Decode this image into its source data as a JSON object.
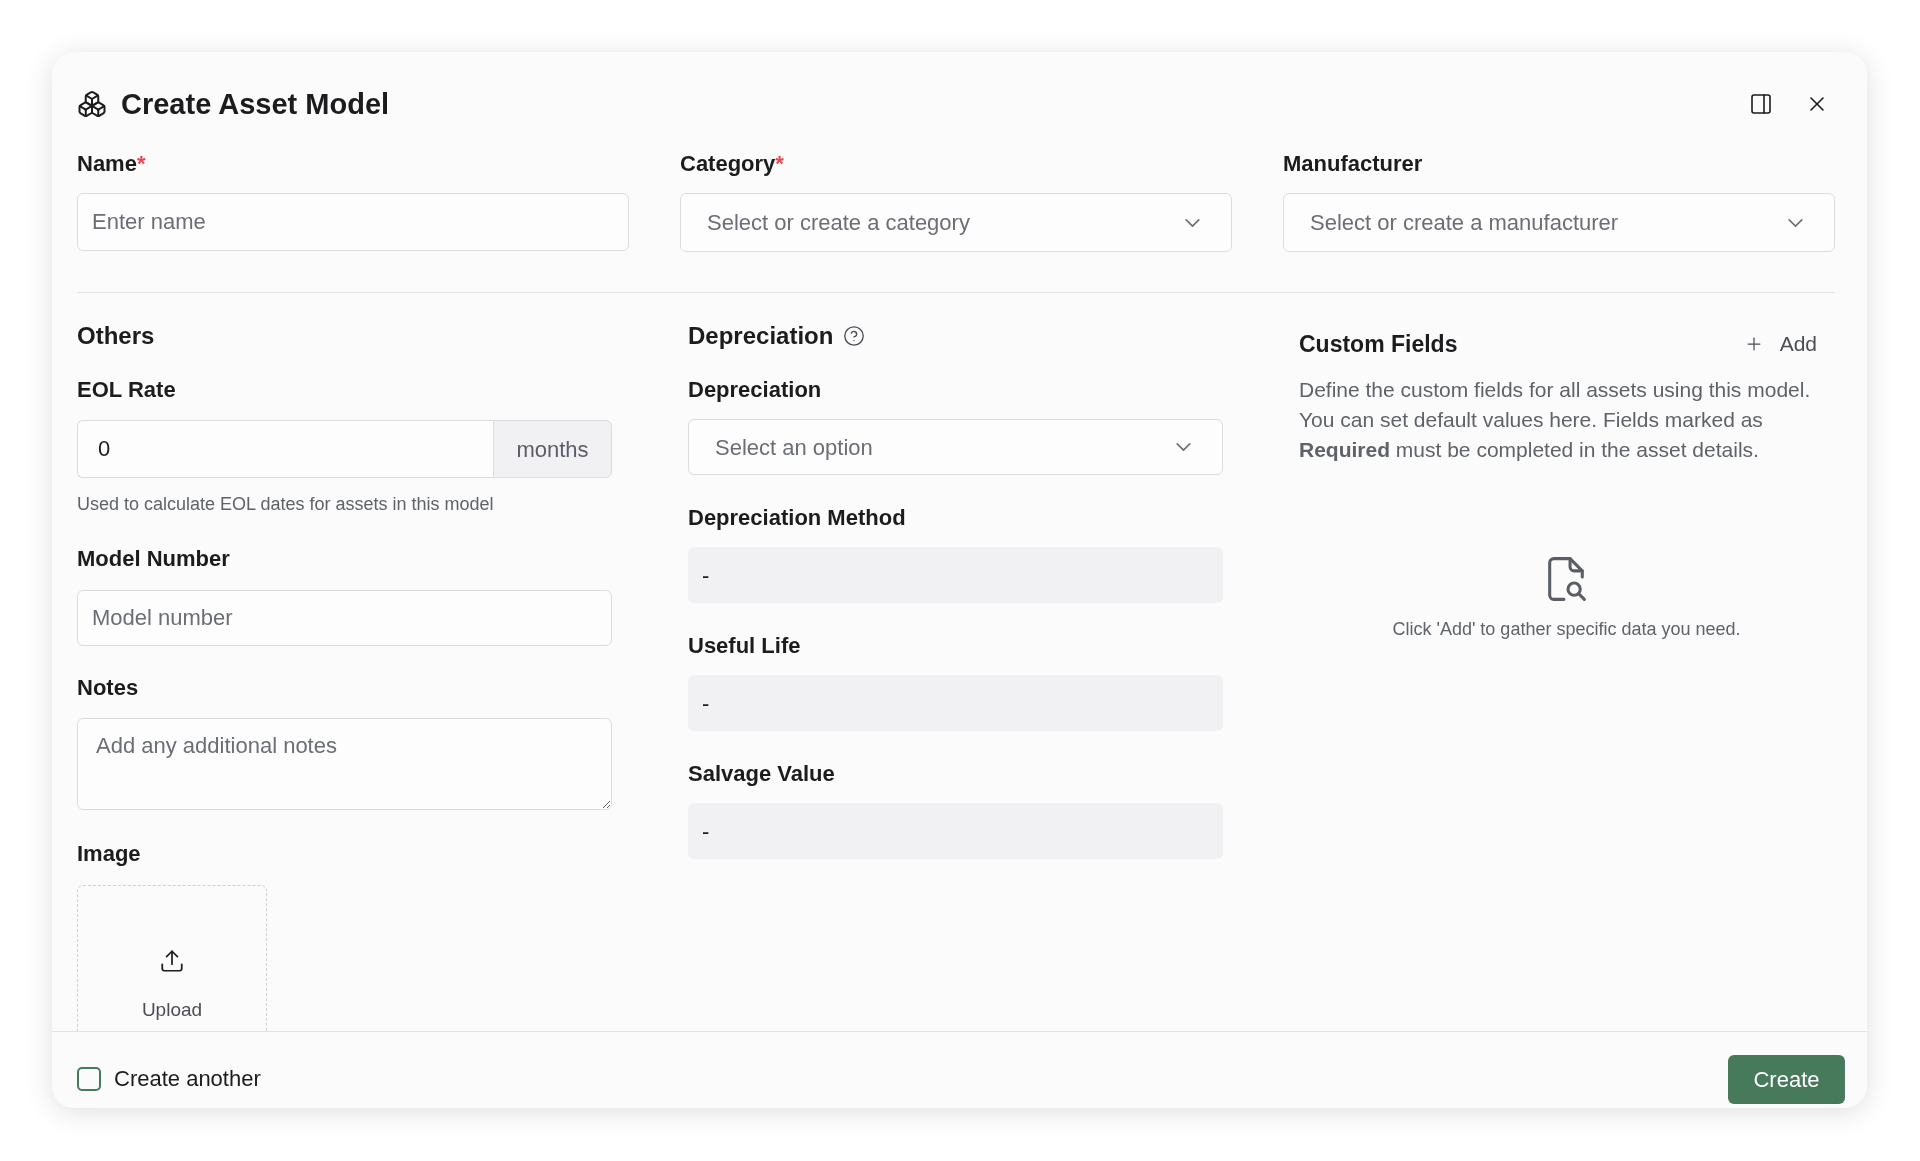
{
  "dialog": {
    "title": "Create Asset Model"
  },
  "top_fields": [
    {
      "kind": "text",
      "label": "Name",
      "required_mark": "*",
      "placeholder": "Enter name"
    },
    {
      "kind": "select",
      "label": "Category",
      "required_mark": "*",
      "placeholder": "Select or create a category"
    },
    {
      "kind": "select",
      "label": "Manufacturer",
      "placeholder": "Select or create a manufacturer"
    }
  ],
  "others": {
    "heading": "Others",
    "eol_rate": {
      "label": "EOL Rate",
      "value": "0",
      "unit": "months",
      "hint": "Used to calculate EOL dates for assets in this model"
    },
    "model_number": {
      "label": "Model Number",
      "placeholder": "Model number"
    },
    "notes": {
      "label": "Notes",
      "placeholder": "Add any additional notes"
    },
    "image": {
      "label": "Image",
      "upload_label": "Upload"
    }
  },
  "depreciation": {
    "heading": "Depreciation",
    "fields": [
      {
        "kind": "select",
        "label": "Depreciation",
        "placeholder": "Select an option"
      },
      {
        "kind": "readonly",
        "label": "Depreciation Method",
        "value": "-"
      },
      {
        "kind": "readonly",
        "label": "Useful Life",
        "value": "-"
      },
      {
        "kind": "readonly",
        "label": "Salvage Value",
        "value": "-"
      }
    ]
  },
  "custom_fields": {
    "heading": "Custom Fields",
    "add_button": "Add",
    "description": "Define the custom fields for all assets using this model. You can set default values here. Fields marked as **Required** must be completed in the asset details.",
    "empty_message": "Click 'Add' to gather specific data you need."
  },
  "footer": {
    "create_another": {
      "label": "Create another",
      "checked": false
    },
    "create_button": "Create"
  }
}
